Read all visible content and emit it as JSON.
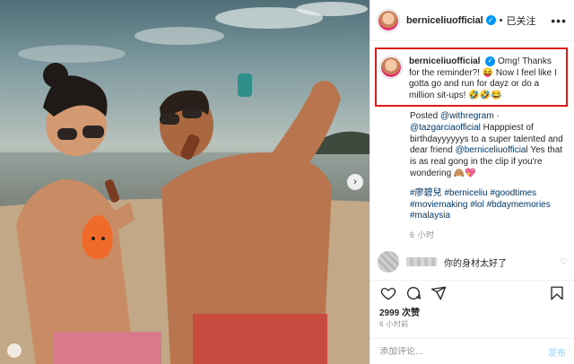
{
  "post": {
    "username": "berniceliuofficial",
    "follow_state": "已关注",
    "caption_username": "berniceliuofficial",
    "caption_text": "Omg! Thanks for the reminder?! 😝 Now I feel like I gotta go and run for dayz or do a million sit-ups! 🤣🤣😂",
    "body_lines": {
      "posted": "Posted ",
      "regram": "@withregram",
      "dot": " · ",
      "tazgarcia": "@tazgarciaofficial",
      "text1": " Happpiest of birthdayyyyyys to a super talented and dear friend ",
      "bernice": "@berniceliuofficial",
      "text2": " Yes that is as real gong in the clip if you're wondering 🙈💖"
    },
    "hashtags": "#廖碧兒 #berniceliu #goodtimes #moviemaking #lol #bdaymemories #malaysia",
    "caption_time": "6 小时",
    "reply_text": "你的身材太好了",
    "likes": "2999 次赞",
    "post_time": "6 小时前",
    "comment_placeholder": "添加评论...",
    "post_button": "发布"
  },
  "icons": {
    "more": "more-icon",
    "heart": "heart-icon",
    "comment": "comment-icon",
    "share": "share-icon",
    "save": "bookmark-icon",
    "next": "chevron-right-icon",
    "verified": "verified-badge-icon"
  },
  "colors": {
    "accent_border": "#e01b1b",
    "link": "#00376b",
    "verified": "#0095f6"
  }
}
